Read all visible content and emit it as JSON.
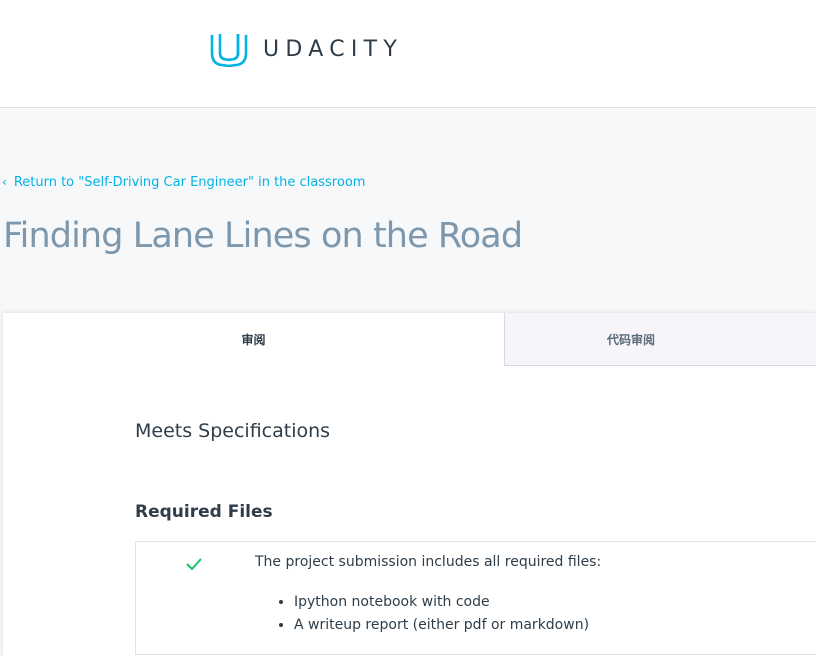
{
  "header": {
    "brand": "UDACITY",
    "brand_color": "#02b3e4",
    "logo_icon": "udacity-logo-icon"
  },
  "hero": {
    "back_chevron": "‹",
    "back_link": "Return to \"Self-Driving Car Engineer\" in the classroom",
    "title": "Finding Lane Lines on the Road"
  },
  "tabs": [
    {
      "label": "审阅",
      "active": true
    },
    {
      "label": "代码审阅",
      "active": false
    }
  ],
  "review": {
    "status": "Meets Specifications",
    "sections": [
      {
        "title": "Required Files",
        "rubrics": [
          {
            "status_icon": "check-icon",
            "status_color": "#15c26b",
            "text": "The project submission includes all required files:",
            "bullets": [
              "Ipython notebook with code",
              "A writeup report (either pdf or markdown)"
            ]
          }
        ]
      }
    ]
  }
}
